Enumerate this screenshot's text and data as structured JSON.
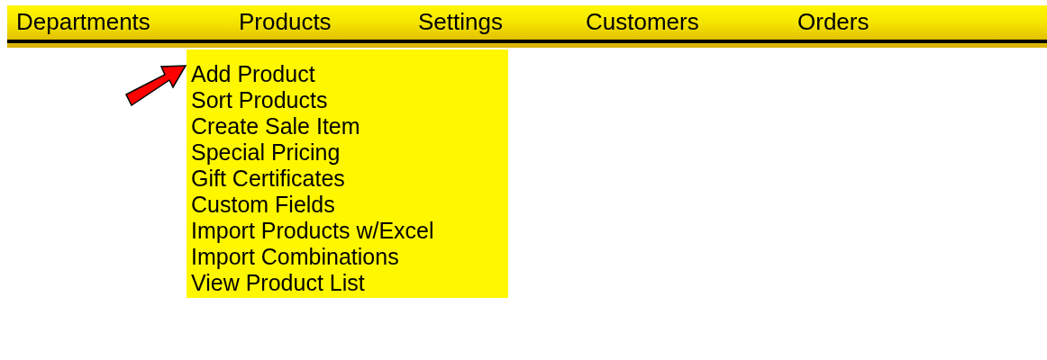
{
  "menu_bar": [
    {
      "label": "Departments"
    },
    {
      "label": "Products",
      "dropdown": [
        "Add Product",
        "Sort Products",
        "Create Sale Item",
        "Special Pricing",
        "Gift Certificates",
        "Custom Fields",
        "Import Products w/Excel",
        "Import Combinations",
        "View Product List"
      ]
    },
    {
      "label": "Settings"
    },
    {
      "label": "Customers"
    },
    {
      "label": "Orders"
    }
  ]
}
